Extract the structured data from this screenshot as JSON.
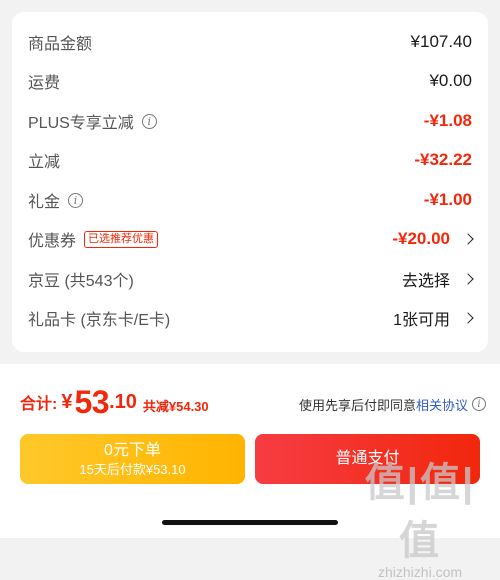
{
  "summary": {
    "rows": [
      {
        "label": "商品金额",
        "value": "¥107.40"
      },
      {
        "label": "运费",
        "value": "¥0.00"
      },
      {
        "label": "PLUS专享立减",
        "value": "-¥1.08"
      },
      {
        "label": "立减",
        "value": "-¥32.22"
      },
      {
        "label": "礼金",
        "value": "-¥1.00"
      },
      {
        "label": "优惠券",
        "tag": "已选推荐优惠",
        "value": "-¥20.00"
      },
      {
        "label": "京豆 (共543个)",
        "value": "去选择"
      },
      {
        "label": "礼品卡 (京东卡/E卡)",
        "value": "1张可用"
      }
    ]
  },
  "footer": {
    "total_label": "合计:",
    "currency": "¥",
    "total_int": "53",
    "total_dec": ".10",
    "saved": "共减¥54.30",
    "agree_prefix": "使用先享后付即同意",
    "agree_link": "相关协议",
    "pay_later_title": "0元下单",
    "pay_later_sub": "15天后付款¥53.10",
    "normal_pay": "普通支付"
  },
  "watermark": {
    "chars": "值|值|值",
    "url": "zhizhizhi.com"
  },
  "colors": {
    "red": "#f2270c",
    "yellow": "#ffc82a",
    "link": "#2f5bc9"
  }
}
